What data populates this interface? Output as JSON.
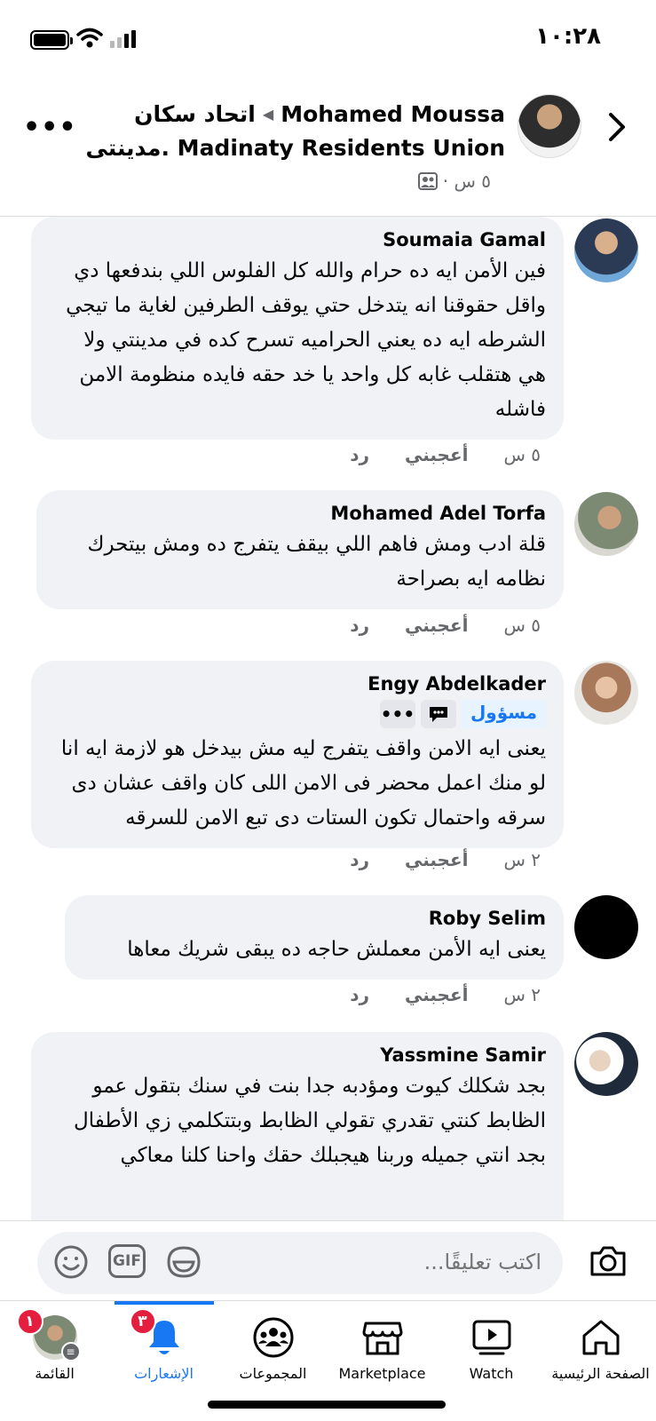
{
  "status_bar": {
    "time": "١٠:٢٨"
  },
  "post": {
    "author": "Mohamed Moussa",
    "group_name_line1": "اتحاد سكان",
    "group_name_line2": "مدينتى. Madinaty Residents Union",
    "time": "٥ س ·"
  },
  "comments": [
    {
      "name": "Soumaia Gamal",
      "text": "فين الأمن ايه ده حرام والله كل الفلوس اللي بندفعها دي واقل حقوقنا انه يتدخل حتي يوقف الطرفين لغاية ما تيجي الشرطه ايه ده يعني الحراميه تسرح كده في مدينتي ولا هي هتقلب غابه كل واحد يا خد حقه فايده منظومة الامن فاشله",
      "time": "٥ س",
      "like": "أعجبني",
      "reply": "رد"
    },
    {
      "name": "Mohamed Adel Torfa",
      "text": "قلة ادب ومش فاهم اللي بيقف يتفرج ده ومش بيتحرك نظامه ايه بصراحة",
      "time": "٥ س",
      "like": "أعجبني",
      "reply": "رد"
    },
    {
      "name": "Engy Abdelkader",
      "badge": "مسؤول",
      "text": "يعنى ايه الامن واقف يتفرج ليه مش بيدخل هو لازمة ايه انا لو منك اعمل محضر فى الامن اللى كان واقف عشان دى سرقه واحتمال تكون الستات دى تبع الامن للسرقه",
      "time": "٢ س",
      "like": "أعجبني",
      "reply": "رد"
    },
    {
      "name": "Roby Selim",
      "text": "يعنى ايه الأمن معملش حاجه ده يبقى شريك معاها",
      "time": "٢ س",
      "like": "أعجبني",
      "reply": "رد"
    },
    {
      "name": "Yassmine Samir",
      "text": "بجد شكلك كيوت ومؤدبه جدا بنت في سنك بتقول عمو الظابط  كنتي تقدري تقولي الظابط وبتتكلمي زي الأطفال بجد انتي جميله وربنا هيجبلك حقك واحنا كلنا معاكي"
    }
  ],
  "composer": {
    "placeholder": "اكتب تعليقًا...",
    "gif_label": "GIF"
  },
  "tabs": [
    {
      "label": "الصفحة الرئيسية",
      "icon": "home-icon"
    },
    {
      "label": "Watch",
      "icon": "watch-icon"
    },
    {
      "label": "Marketplace",
      "icon": "marketplace-icon"
    },
    {
      "label": "المجموعات",
      "icon": "groups-icon"
    },
    {
      "label": "الإشعارات",
      "icon": "bell-icon",
      "badge": "٣",
      "active": true
    },
    {
      "label": "القائمة",
      "icon": "menu-avatar-icon",
      "badge": "١"
    }
  ],
  "colors": {
    "accent": "#1877f2",
    "bubble": "#f0f2f5",
    "badge_red": "#e41e3f",
    "meta_gray": "#65676b"
  }
}
